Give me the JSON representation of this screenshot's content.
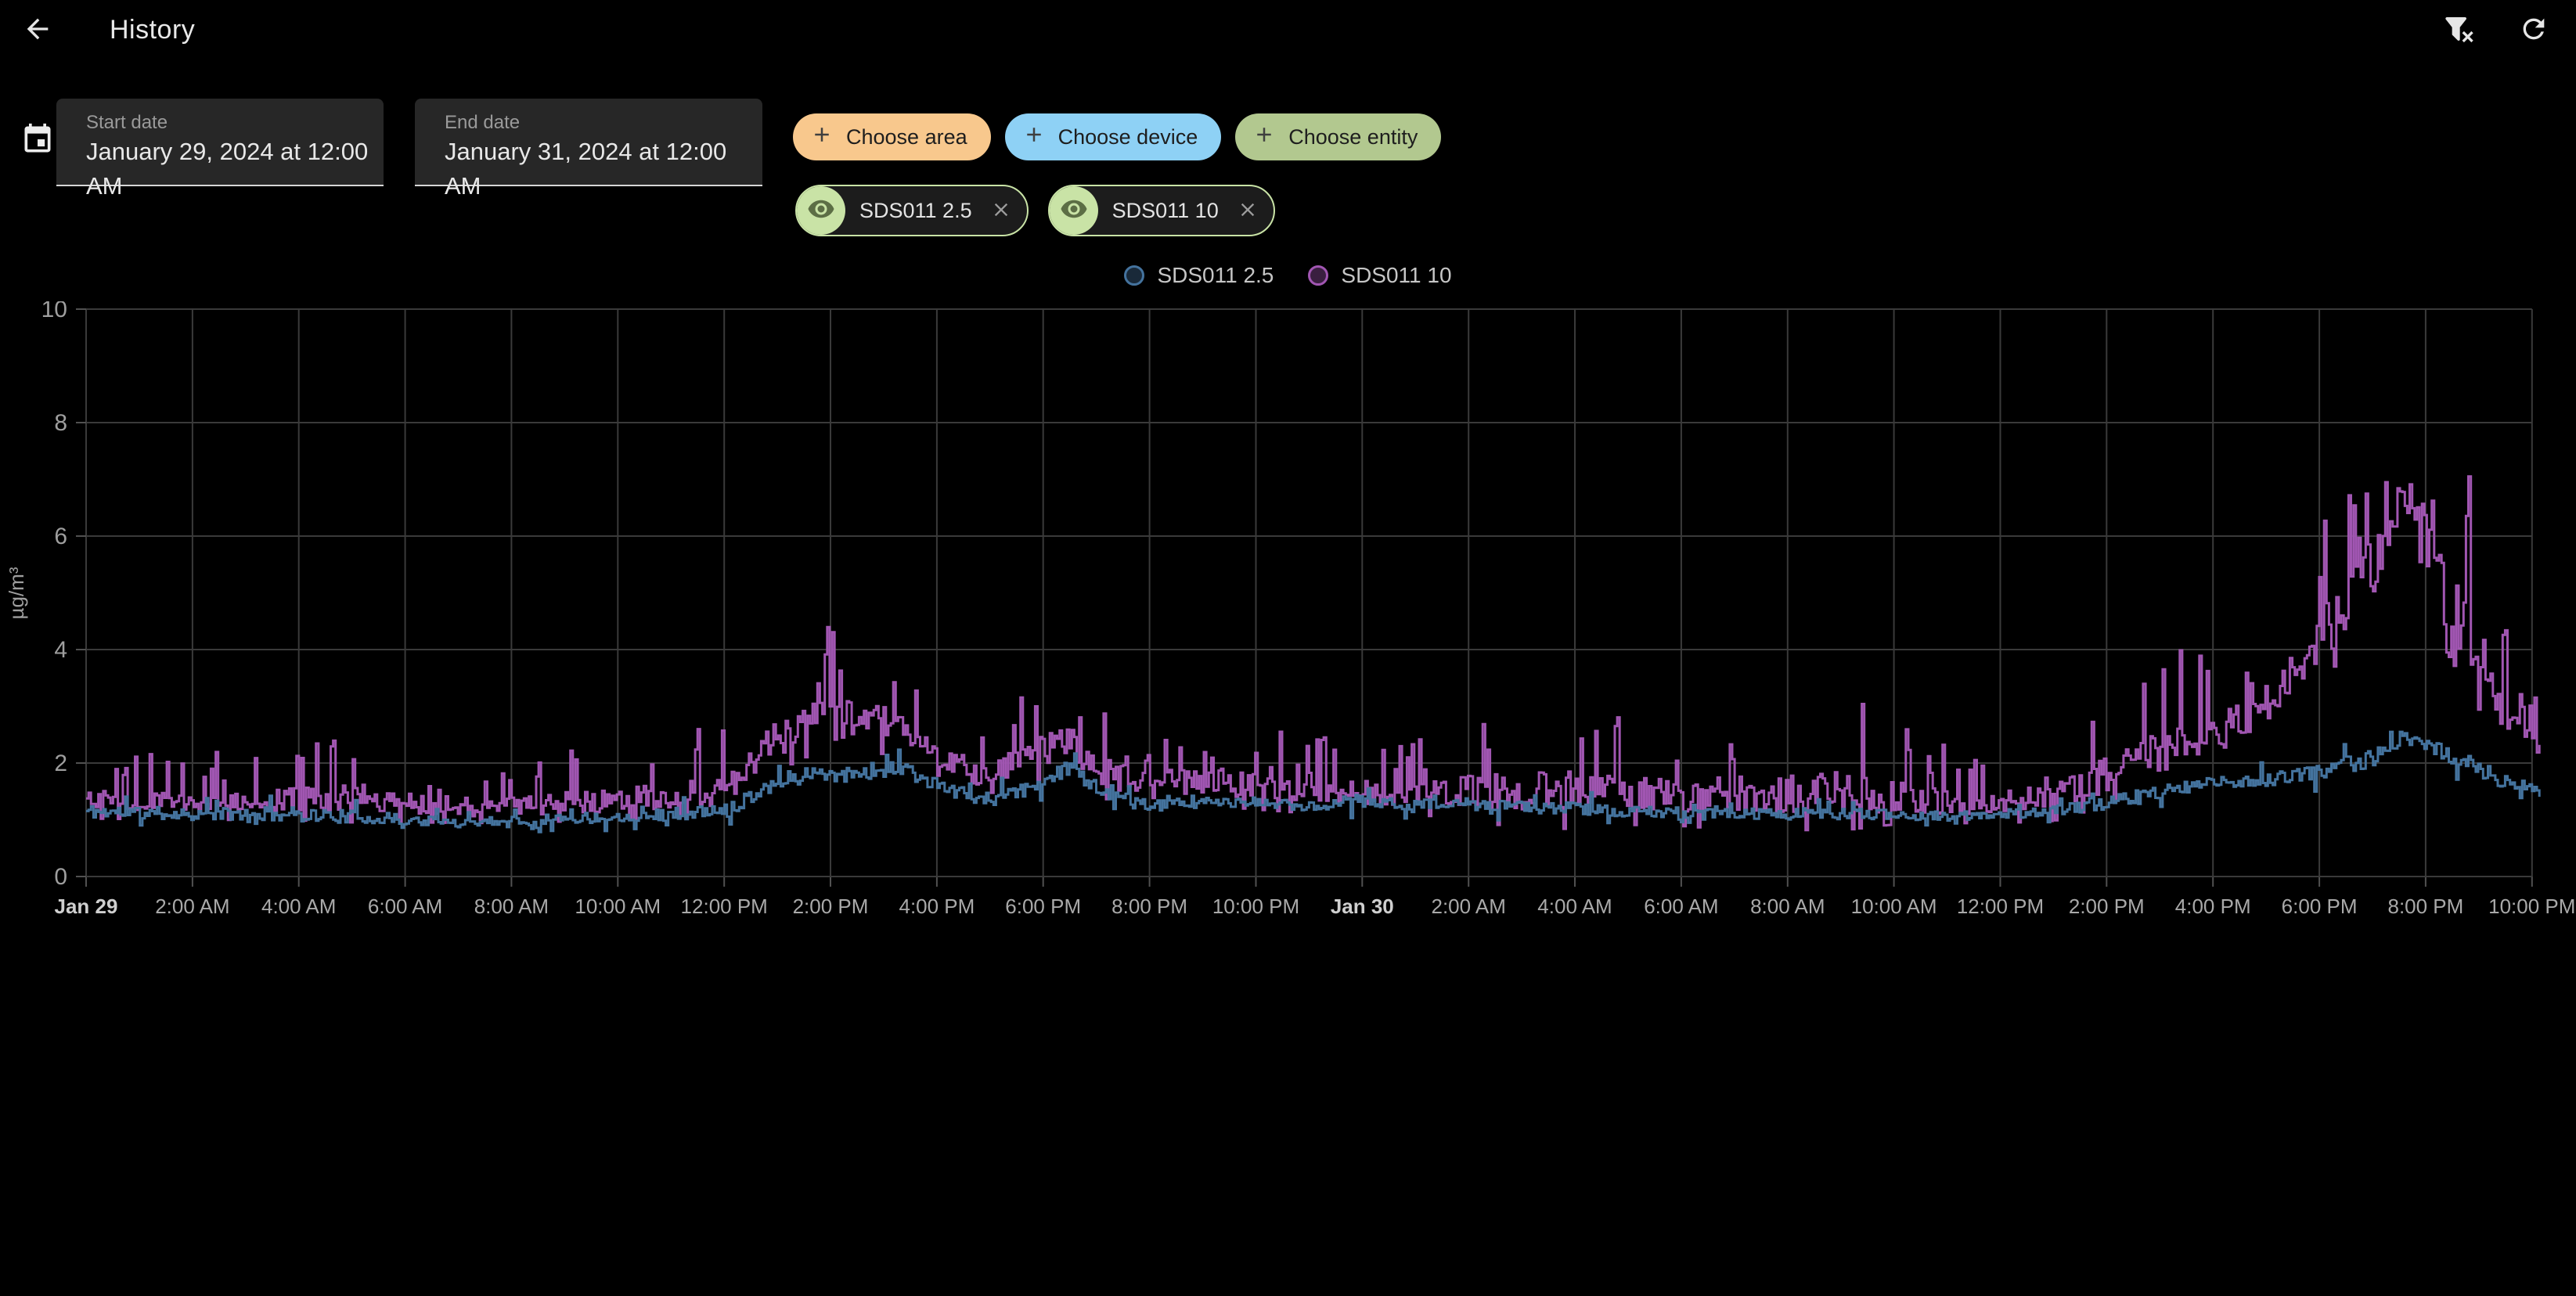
{
  "header": {
    "title": "History"
  },
  "toolbar": {
    "back_icon": "arrow-left",
    "filter_icon": "filter-remove",
    "refresh_icon": "refresh"
  },
  "date_range": {
    "calendar_icon": "calendar",
    "start": {
      "label": "Start date",
      "value": "January 29, 2024 at 12:00 AM"
    },
    "end": {
      "label": "End date",
      "value": "January 31, 2024 at 12:00 AM"
    }
  },
  "filter_chips": [
    {
      "label": "Choose area",
      "icon": "plus",
      "color": "#f8c88d"
    },
    {
      "label": "Choose device",
      "icon": "plus",
      "color": "#8ed1f5"
    },
    {
      "label": "Choose entity",
      "icon": "plus",
      "color": "#b2c88f"
    }
  ],
  "entity_chip_accent": "#c9e3a6",
  "entity_chips": [
    {
      "label": "SDS011 2.5",
      "visibility_icon": "eye",
      "remove_icon": "close"
    },
    {
      "label": "SDS011 10",
      "visibility_icon": "eye",
      "remove_icon": "close"
    }
  ],
  "legend": [
    {
      "label": "SDS011 2.5",
      "color": "#44739e"
    },
    {
      "label": "SDS011 10",
      "color": "#a156b2"
    }
  ],
  "chart_data": {
    "type": "line",
    "style": "stepped-noisy",
    "ylabel": "µg/m³",
    "ylim": [
      0,
      10
    ],
    "y_ticks": [
      0,
      2,
      4,
      6,
      8,
      10
    ],
    "grid": true,
    "grid_color": "#3a3a3a",
    "tick_color": "#515151",
    "axis_text_color": "#a9a9a9",
    "x_span_hours": 46,
    "x_tick_interval_hours": 2,
    "x_ticks": [
      {
        "label": "Jan 29",
        "bold": true
      },
      {
        "label": "2:00 AM",
        "bold": false
      },
      {
        "label": "4:00 AM",
        "bold": false
      },
      {
        "label": "6:00 AM",
        "bold": false
      },
      {
        "label": "8:00 AM",
        "bold": false
      },
      {
        "label": "10:00 AM",
        "bold": false
      },
      {
        "label": "12:00 PM",
        "bold": false
      },
      {
        "label": "2:00 PM",
        "bold": false
      },
      {
        "label": "4:00 PM",
        "bold": false
      },
      {
        "label": "6:00 PM",
        "bold": false
      },
      {
        "label": "8:00 PM",
        "bold": false
      },
      {
        "label": "10:00 PM",
        "bold": false
      },
      {
        "label": "Jan 30",
        "bold": true
      },
      {
        "label": "2:00 AM",
        "bold": false
      },
      {
        "label": "4:00 AM",
        "bold": false
      },
      {
        "label": "6:00 AM",
        "bold": false
      },
      {
        "label": "8:00 AM",
        "bold": false
      },
      {
        "label": "10:00 AM",
        "bold": false
      },
      {
        "label": "12:00 PM",
        "bold": false
      },
      {
        "label": "2:00 PM",
        "bold": false
      },
      {
        "label": "4:00 PM",
        "bold": false
      },
      {
        "label": "6:00 PM",
        "bold": false
      },
      {
        "label": "8:00 PM",
        "bold": false
      },
      {
        "label": "10:00 PM",
        "bold": false
      }
    ],
    "series": [
      {
        "name": "SDS011 2.5",
        "color": "#44739e",
        "seed": 11,
        "max_value": 2.55,
        "anchors": [
          [
            0,
            1.15,
            0.18
          ],
          [
            2,
            1.1,
            0.15
          ],
          [
            4,
            1.1,
            0.18
          ],
          [
            6,
            1.0,
            0.14
          ],
          [
            7,
            0.95,
            0.12
          ],
          [
            8,
            1.0,
            0.12
          ],
          [
            10,
            1.05,
            0.14
          ],
          [
            12,
            1.15,
            0.18
          ],
          [
            12.8,
            1.6,
            0.2
          ],
          [
            13.5,
            1.8,
            0.22
          ],
          [
            14.5,
            1.85,
            0.22
          ],
          [
            15.3,
            1.9,
            0.2
          ],
          [
            16,
            1.6,
            0.16
          ],
          [
            16.8,
            1.35,
            0.14
          ],
          [
            17.6,
            1.5,
            0.18
          ],
          [
            18.5,
            1.9,
            0.2
          ],
          [
            19.2,
            1.45,
            0.15
          ],
          [
            20,
            1.25,
            0.13
          ],
          [
            21,
            1.3,
            0.15
          ],
          [
            22,
            1.3,
            0.13
          ],
          [
            23,
            1.25,
            0.13
          ],
          [
            24,
            1.3,
            0.14
          ],
          [
            26,
            1.25,
            0.13
          ],
          [
            28,
            1.2,
            0.16
          ],
          [
            30,
            1.1,
            0.14
          ],
          [
            32,
            1.1,
            0.14
          ],
          [
            34,
            1.1,
            0.13
          ],
          [
            35,
            1.05,
            0.12
          ],
          [
            36,
            1.1,
            0.12
          ],
          [
            37,
            1.15,
            0.13
          ],
          [
            38,
            1.3,
            0.16
          ],
          [
            39,
            1.5,
            0.16
          ],
          [
            40,
            1.65,
            0.16
          ],
          [
            41,
            1.7,
            0.16
          ],
          [
            42,
            1.85,
            0.2
          ],
          [
            43,
            2.1,
            0.25
          ],
          [
            43.7,
            2.45,
            0.2
          ],
          [
            44.3,
            2.2,
            0.2
          ],
          [
            44.9,
            1.95,
            0.2
          ],
          [
            45.4,
            1.7,
            0.18
          ],
          [
            46.2,
            1.5,
            0.2
          ]
        ]
      },
      {
        "name": "SDS011 10",
        "color": "#a156b2",
        "seed": 97,
        "max_value": 8.07,
        "anchors": [
          [
            0,
            1.35,
            0.55
          ],
          [
            2,
            1.3,
            0.5
          ],
          [
            4,
            1.35,
            0.6
          ],
          [
            5.3,
            1.45,
            0.85
          ],
          [
            6,
            1.2,
            0.4
          ],
          [
            7,
            1.15,
            0.35
          ],
          [
            8,
            1.25,
            0.5
          ],
          [
            10,
            1.35,
            0.6
          ],
          [
            12,
            1.5,
            0.7
          ],
          [
            12.8,
            2.3,
            0.9
          ],
          [
            13.5,
            2.7,
            1.0
          ],
          [
            14.5,
            2.8,
            1.0
          ],
          [
            15.3,
            2.7,
            0.95
          ],
          [
            16,
            2.2,
            0.7
          ],
          [
            16.8,
            1.75,
            0.55
          ],
          [
            17.6,
            2.1,
            0.8
          ],
          [
            18.5,
            2.35,
            0.9
          ],
          [
            19.2,
            1.8,
            0.75
          ],
          [
            20,
            1.6,
            0.7
          ],
          [
            21,
            1.7,
            0.75
          ],
          [
            22,
            1.6,
            0.7
          ],
          [
            23,
            1.5,
            0.65
          ],
          [
            24,
            1.5,
            0.65
          ],
          [
            25,
            1.45,
            0.6
          ],
          [
            26,
            1.5,
            0.85
          ],
          [
            27,
            1.5,
            1.1
          ],
          [
            28,
            1.5,
            1.1
          ],
          [
            29,
            1.45,
            0.9
          ],
          [
            30,
            1.4,
            0.85
          ],
          [
            31,
            1.5,
            1.15
          ],
          [
            32,
            1.45,
            1.05
          ],
          [
            33,
            1.5,
            1.15
          ],
          [
            34,
            1.4,
            0.8
          ],
          [
            35,
            1.3,
            0.6
          ],
          [
            36,
            1.3,
            0.6
          ],
          [
            37,
            1.4,
            0.7
          ],
          [
            38,
            1.8,
            0.9
          ],
          [
            39,
            2.2,
            1.0
          ],
          [
            40,
            2.45,
            1.0
          ],
          [
            41,
            3.0,
            1.05
          ],
          [
            42,
            4.2,
            1.3
          ],
          [
            43,
            5.4,
            1.6
          ],
          [
            43.7,
            6.9,
            1.2
          ],
          [
            44.3,
            5.0,
            1.5
          ],
          [
            44.9,
            4.1,
            1.7
          ],
          [
            45.4,
            2.9,
            1.0
          ],
          [
            46.2,
            2.3,
            0.6
          ]
        ]
      }
    ]
  }
}
